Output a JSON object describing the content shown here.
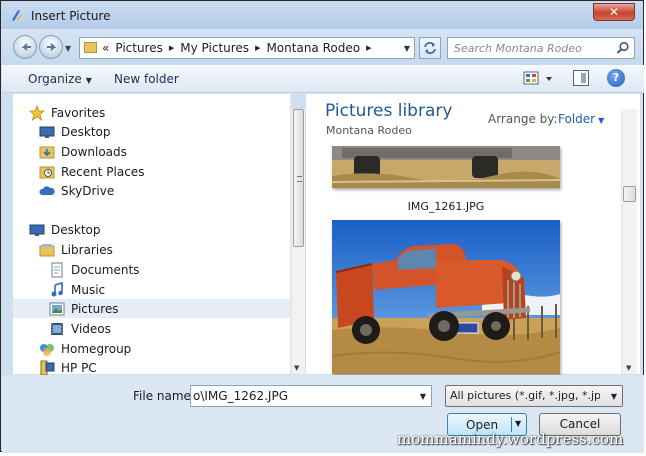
{
  "window": {
    "title": "Insert Picture",
    "close_label": "✕"
  },
  "address": {
    "prefix": "«",
    "crumbs": [
      "Pictures",
      "My Pictures",
      "Montana Rodeo"
    ]
  },
  "search": {
    "placeholder": "Search Montana Rodeo"
  },
  "toolbar": {
    "organize_label": "Organize",
    "new_folder_label": "New folder",
    "help_label": "?"
  },
  "nav": {
    "favorites": "Favorites",
    "favorite_items": [
      "Desktop",
      "Downloads",
      "Recent Places",
      "SkyDrive"
    ],
    "desktop": "Desktop",
    "libraries": "Libraries",
    "library_items": [
      "Documents",
      "Music",
      "Pictures",
      "Videos"
    ],
    "homegroup": "Homegroup",
    "pc": "HP PC",
    "selected": "Pictures"
  },
  "library": {
    "title": "Pictures library",
    "subtitle": "Montana Rodeo",
    "arrange_label": "Arrange by:",
    "arrange_value": "Folder"
  },
  "files": [
    {
      "name": "IMG_1261.JPG"
    },
    {
      "name": ""
    }
  ],
  "bottom": {
    "file_name_label": "File name:",
    "file_name_value": "o\\IMG_1262.JPG",
    "filter_value": "All pictures (*.gif, *.jpg, *.jpeg, *",
    "open_label": "Open",
    "cancel_label": "Cancel"
  },
  "watermark": "mommamindy.wordpress.com",
  "colors": {
    "accent": "#1e5b94",
    "link": "#1e5bc4",
    "selection": "#e6edf6"
  }
}
